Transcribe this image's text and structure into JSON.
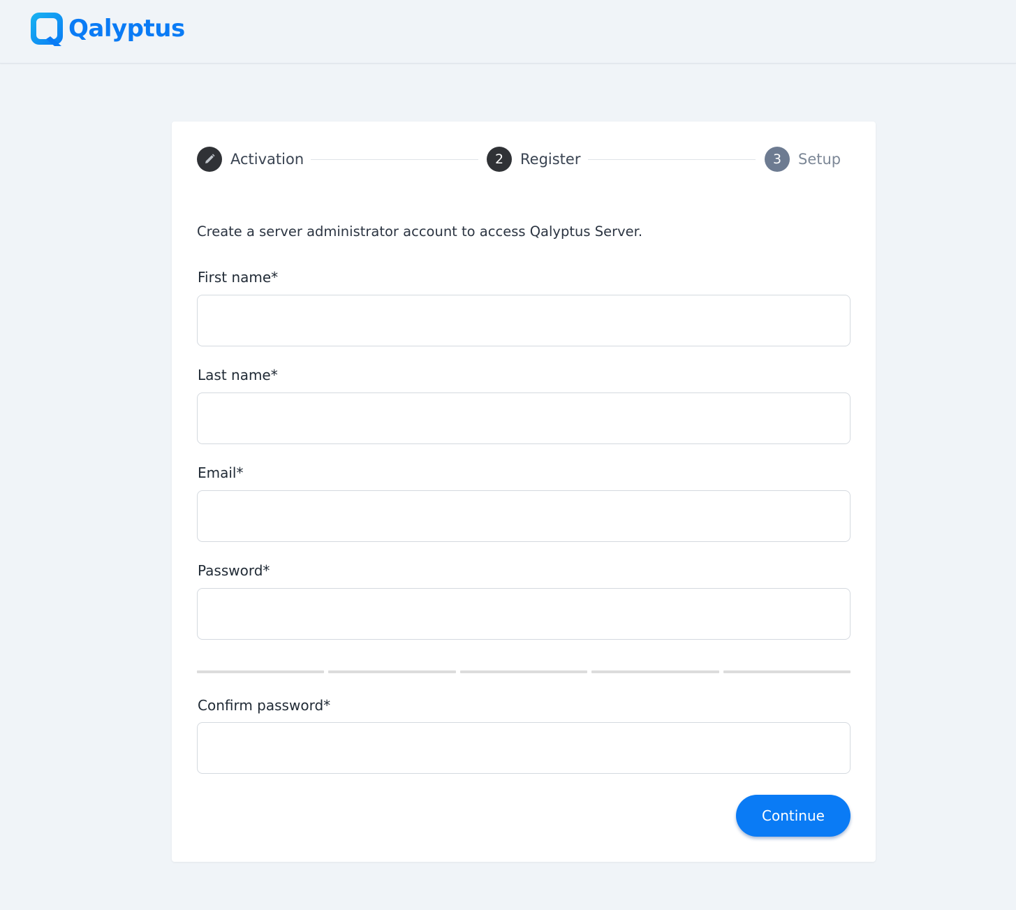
{
  "header": {
    "logo_text": "Qalyptus",
    "brand_color": "#0a7bf5"
  },
  "stepper": {
    "steps": [
      {
        "number": "",
        "label": "Activation",
        "state": "done",
        "icon": "pencil-icon"
      },
      {
        "number": "2",
        "label": "Register",
        "state": "active"
      },
      {
        "number": "3",
        "label": "Setup",
        "state": "pending"
      }
    ]
  },
  "form": {
    "intro": "Create a server administrator account to access Qalyptus Server.",
    "fields": {
      "first_name": {
        "label": "First name*",
        "value": ""
      },
      "last_name": {
        "label": "Last name*",
        "value": ""
      },
      "email": {
        "label": "Email*",
        "value": ""
      },
      "password": {
        "label": "Password*",
        "value": ""
      },
      "confirm_password": {
        "label": "Confirm password*",
        "value": ""
      }
    },
    "password_strength_segments": 5,
    "continue_label": "Continue"
  }
}
